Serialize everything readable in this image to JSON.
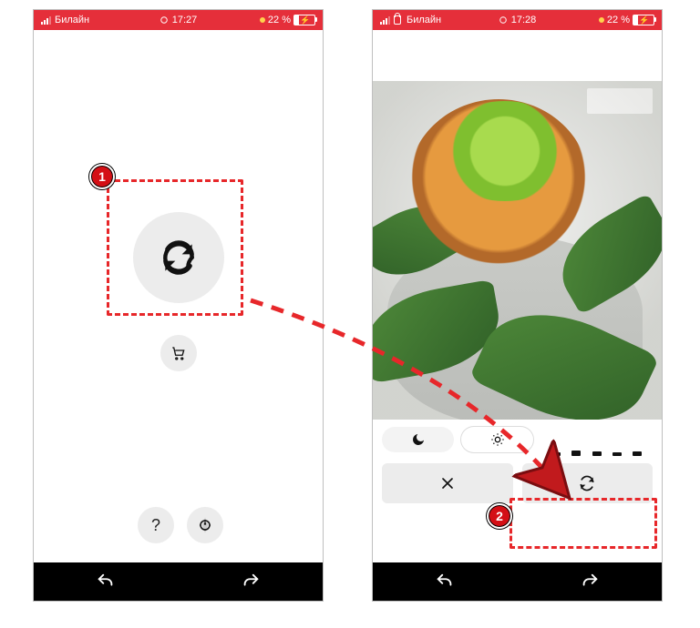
{
  "annotations": {
    "step1": "1",
    "step2": "2"
  },
  "left_phone": {
    "status": {
      "carrier": "Билайн",
      "time": "17:27",
      "battery_percent": "22 %"
    },
    "icons": {
      "main": "refresh-icon",
      "cart": "cart-icon",
      "help": "?",
      "settings": "settings-icon",
      "nav_undo": "undo-icon",
      "nav_redo": "redo-icon"
    }
  },
  "right_phone": {
    "status": {
      "carrier": "Билайн",
      "time": "17:28",
      "battery_percent": "22 %"
    },
    "controls_row1": {
      "mode_night": "night-icon",
      "mode_bright": "brightness-icon",
      "mode_levels": "levels-icon"
    },
    "controls_row2": {
      "cancel": "close-icon",
      "apply": "refresh-icon"
    },
    "nav": {
      "undo": "undo-icon",
      "redo": "redo-icon"
    }
  }
}
